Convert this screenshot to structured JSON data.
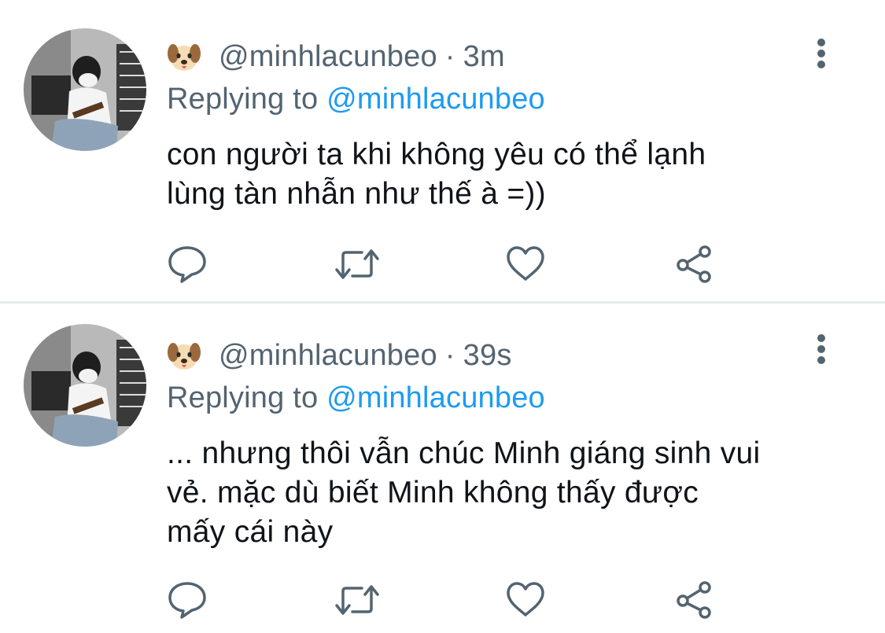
{
  "tweets": [
    {
      "author_emoji": "dog-face",
      "handle": "@minhlacunbeo",
      "separator": "·",
      "time": "3m",
      "replying_prefix": "Replying to",
      "replying_to": "@minhlacunbeo",
      "text_lines": [
        "con người ta khi không yêu có thể lạnh",
        "lùng tàn nhẫn như thế à =))"
      ],
      "actions": [
        "reply-icon",
        "retweet-icon",
        "like-icon",
        "share-icon"
      ]
    },
    {
      "author_emoji": "dog-face",
      "handle": "@minhlacunbeo",
      "separator": "·",
      "time": "39s",
      "replying_prefix": "Replying to",
      "replying_to": "@minhlacunbeo",
      "text_lines": [
        "... nhưng thôi vẫn chúc Minh giáng sinh vui",
        "vẻ. mặc dù biết Minh không thấy được",
        "mấy cái này"
      ],
      "actions": [
        "reply-icon",
        "retweet-icon",
        "like-icon",
        "share-icon"
      ]
    }
  ],
  "colors": {
    "secondary_text": "#536471",
    "mention": "#1d9bf0",
    "divider": "#e6ecf0"
  }
}
